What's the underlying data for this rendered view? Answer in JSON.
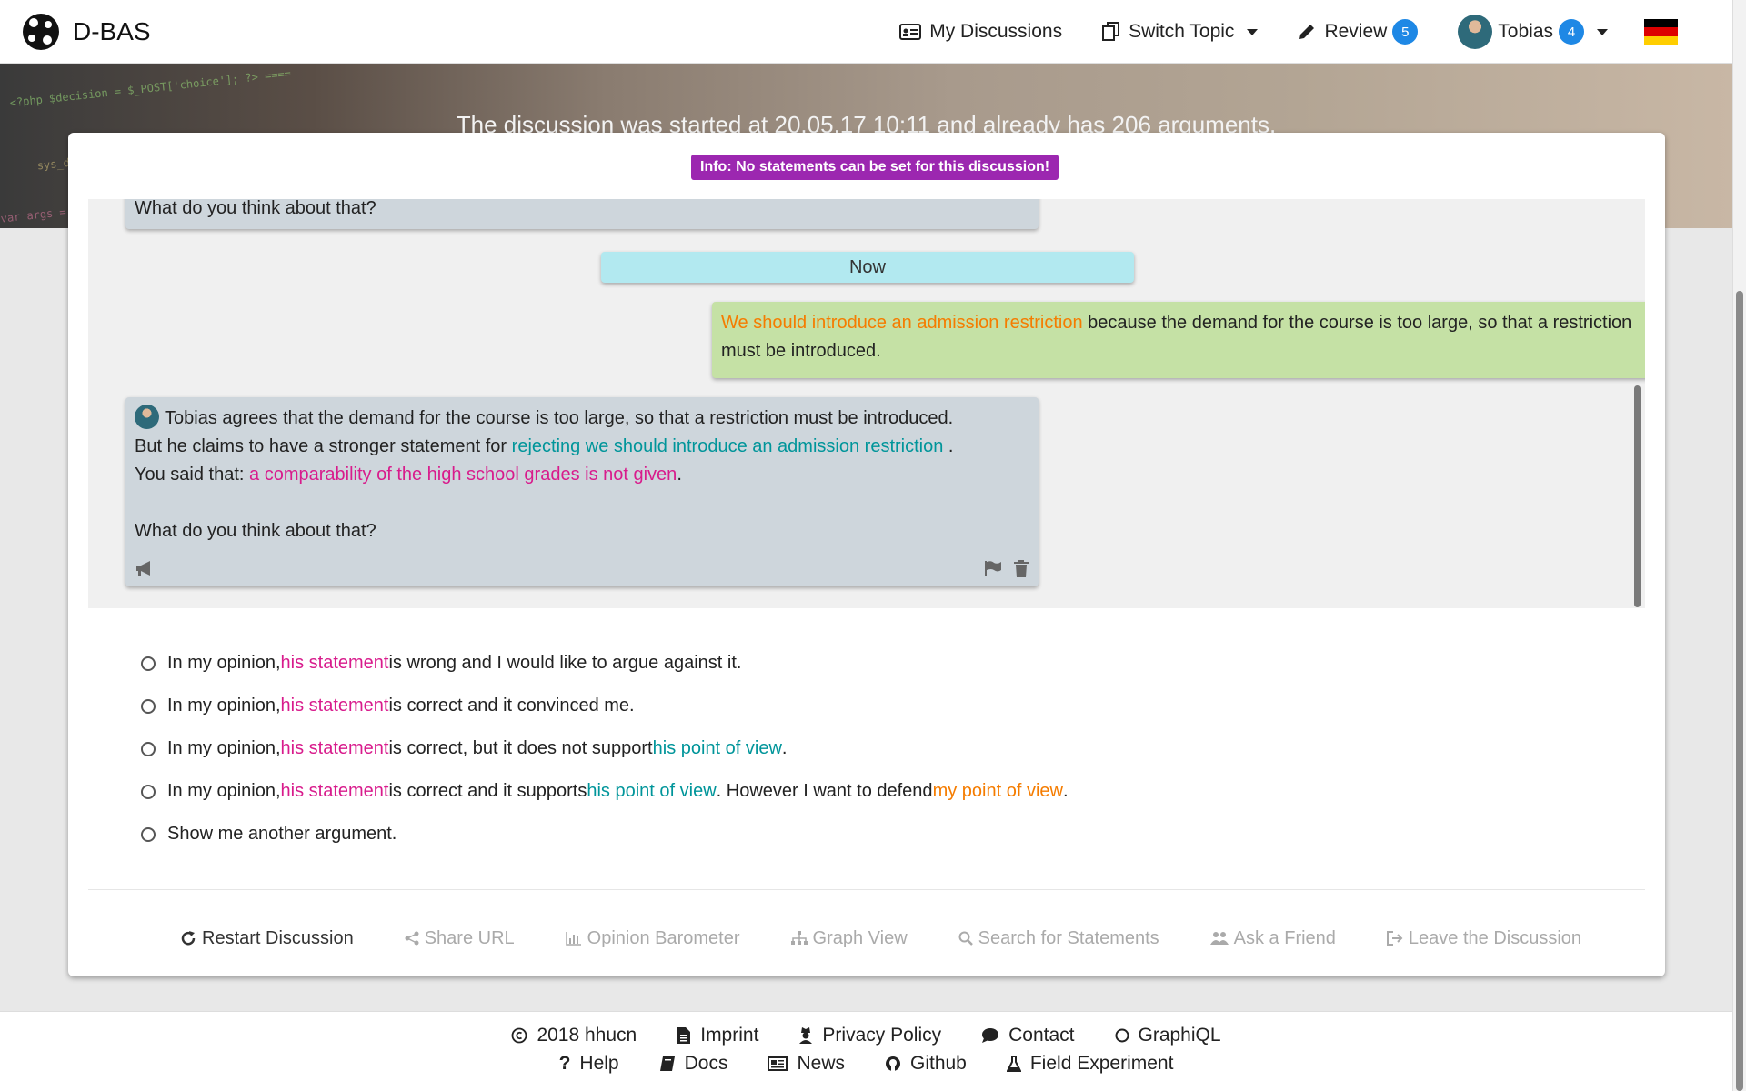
{
  "brand": {
    "name": "D-BAS"
  },
  "nav": {
    "my_discussions": "My Discussions",
    "switch_topic": "Switch Topic",
    "review": "Review",
    "review_count": "5",
    "user": "Tobias",
    "user_count": "4",
    "flag": "german-flag"
  },
  "hero": {
    "text": "The discussion was started at 20.05.17 10:11 and already has 206 arguments."
  },
  "info_badge": "Info: No statements can be set for this discussion!",
  "chat": {
    "prev_bubble": "What do you think about that?",
    "now": "Now",
    "user_bubble": {
      "highlight": "We should introduce an admission restriction",
      "rest": " because the demand for the course is too large, so that a restriction must be introduced."
    },
    "sys_bubble": {
      "line1": "Tobias agrees that the demand for the course is too large, so that a restriction must be introduced.",
      "line2_a": "But he claims to have a stronger statement for ",
      "line2_link": "rejecting we should introduce an admission restriction",
      "line2_b": " .",
      "line3_a": "You said that: ",
      "line3_link": "a comparability of the high school grades is not given",
      "line3_b": ".",
      "question": "What do you think about that?"
    }
  },
  "options": [
    {
      "a": "In my opinion, ",
      "his_statement": "his statement",
      "b": " is wrong and I would like to argue against it."
    },
    {
      "a": "In my opinion, ",
      "his_statement": "his statement",
      "b": " is correct and it convinced me."
    },
    {
      "a": "In my opinion, ",
      "his_statement": "his statement",
      "b": " is correct, but it does not support ",
      "his_pov": "his point of view",
      "c": "."
    },
    {
      "a": "In my opinion, ",
      "his_statement": "his statement",
      "b": " is correct and it supports ",
      "his_pov": "his point of view",
      "c": ". However I want to defend ",
      "my_pov": "my point of view",
      "d": "."
    },
    {
      "a": "Show me another argument."
    }
  ],
  "toolbar": {
    "restart": "Restart Discussion",
    "share": "Share URL",
    "barometer": "Opinion Barometer",
    "graph": "Graph View",
    "search": "Search for Statements",
    "ask": "Ask a Friend",
    "leave": "Leave the Discussion"
  },
  "footer": {
    "copyright": "2018 hhucn",
    "imprint": "Imprint",
    "privacy": "Privacy Policy",
    "contact": "Contact",
    "graphiql": "GraphiQL",
    "help": "Help",
    "docs": "Docs",
    "news": "News",
    "github": "Github",
    "field": "Field Experiment"
  },
  "colors": {
    "badge_purple": "#9c27b0",
    "user_bubble": "#c5e1a5",
    "sys_bubble": "#ced6dc",
    "now_bubble": "#b2e9f0",
    "orange": "#f57c00",
    "teal": "#00959a",
    "pink": "#d81b8c",
    "badge_blue": "#1e88e5"
  }
}
